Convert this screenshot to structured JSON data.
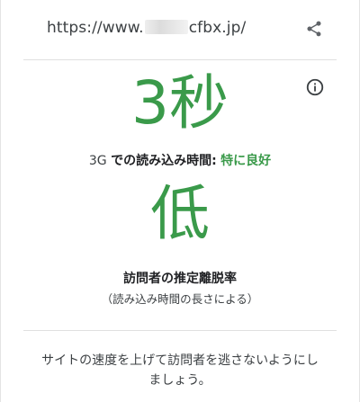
{
  "header": {
    "url_prefix": "https://www.",
    "url_suffix": "cfbx.jp/",
    "share_icon": "share-icon"
  },
  "speed": {
    "info_icon": "info-icon",
    "time_value": "3秒",
    "network_prefix": "3G",
    "network_label": "での読み込み時間",
    "colon": ":",
    "rating": "特に良好"
  },
  "bounce": {
    "value": "低",
    "label": "訪問者の推定離脱率",
    "sublabel": "（読み込み時間の長さによる）"
  },
  "footer": {
    "message": "サイトの速度を上げて訪問者を逃さないようにしましょう。"
  },
  "colors": {
    "accent_green": "#3a9a4a",
    "text": "#202124",
    "divider": "#e0e0e0"
  }
}
